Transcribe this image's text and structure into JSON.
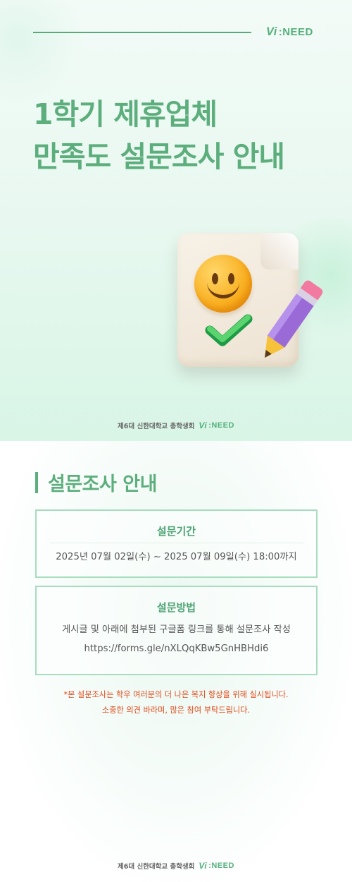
{
  "header": {
    "brand_mark": "Vi",
    "brand_text": ":NEED",
    "title_line1": "1학기 제휴업체",
    "title_line2": "만족도 설문조사 안내"
  },
  "illustration": {
    "icons": [
      "document-icon",
      "smiley-face-icon",
      "check-mark-icon",
      "pencil-icon"
    ]
  },
  "footer": {
    "org": "제6대 신한대학교 총학생회",
    "brand_mark": "Vi",
    "brand_text": ":NEED"
  },
  "section": {
    "title": "설문조사 안내"
  },
  "period": {
    "heading": "설문기간",
    "text": "2025년 07월 02일(수) ~ 2025 07월 09일(수) 18:00까지"
  },
  "method": {
    "heading": "설문방법",
    "text": "게시글 및 아래에 첨부된 구글폼 링크를 통해 설문조사 작성",
    "link": "https://forms.gle/nXLQqKBw5GnHBHdi6"
  },
  "notice": {
    "line1": "*본 설문조사는 학우 여러분의 더 나은 복지 향상을 위해 실시됩니다.",
    "line2": "소중한 의견 바라며, 많은 참여 부탁드립니다."
  },
  "colors": {
    "accent_green": "#5dae7d",
    "card_border": "#a8dcbf",
    "notice_red": "#e24a1c"
  }
}
